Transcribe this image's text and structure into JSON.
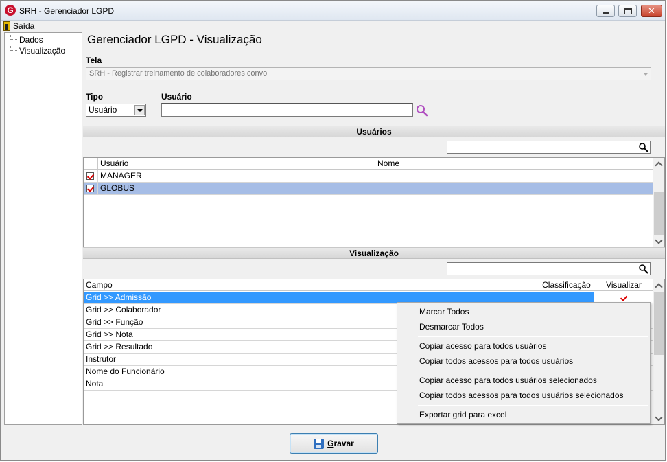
{
  "window": {
    "title": "SRH - Gerenciador LGPD",
    "minimize_symbol": "",
    "close_symbol": "✕"
  },
  "menu": {
    "exit_label": "Saída"
  },
  "tree": {
    "items": [
      "Dados",
      "Visualização"
    ]
  },
  "page_title": "Gerenciador LGPD - Visualização",
  "tela": {
    "label": "Tela",
    "value": "SRH - Registrar treinamento de colaboradores convo"
  },
  "tipo": {
    "label": "Tipo",
    "value": "Usuário"
  },
  "usuario": {
    "label": "Usuário",
    "value": ""
  },
  "users_section": {
    "title": "Usuários",
    "filter_value": "",
    "columns": [
      "Usuário",
      "Nome"
    ],
    "rows": [
      {
        "checked": true,
        "usuario": "MANAGER",
        "nome": "",
        "selected": false
      },
      {
        "checked": true,
        "usuario": "GLOBUS",
        "nome": "",
        "selected": true
      }
    ]
  },
  "visual_section": {
    "title": "Visualização",
    "filter_value": "",
    "columns": [
      "Campo",
      "Classificação",
      "Visualizar"
    ],
    "rows": [
      {
        "campo": "Grid >> Admissão",
        "classificacao": "",
        "visualizar": true,
        "selected": true
      },
      {
        "campo": "Grid >> Colaborador"
      },
      {
        "campo": "Grid >> Função"
      },
      {
        "campo": "Grid >> Nota"
      },
      {
        "campo": "Grid >> Resultado"
      },
      {
        "campo": "Instrutor"
      },
      {
        "campo": "Nome do Funcionário"
      },
      {
        "campo": "Nota"
      }
    ]
  },
  "context_menu": {
    "items": [
      "Marcar Todos",
      "Desmarcar Todos",
      "Copiar acesso para todos usuários",
      "Copiar todos acessos para todos usuários",
      "Copiar acesso para todos usuários selecionados",
      "Copiar todos acessos para todos usuários selecionados",
      "Exportar grid para excel"
    ]
  },
  "buttons": {
    "save_label": "Gravar"
  },
  "icons": {
    "app": "app-logo-icon",
    "exit": "door-exit-icon",
    "search": "magnifier-icon",
    "save": "floppy-disk-icon"
  },
  "colors": {
    "selected_row_blue": "#3399ff",
    "selected_row_light": "#a6bde6",
    "check_red": "#dd0000",
    "search_purple": "#b04fc0",
    "logo_red": "#c8102e"
  }
}
